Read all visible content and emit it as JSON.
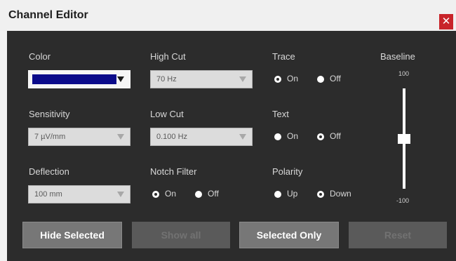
{
  "window": {
    "title": "Channel Editor",
    "close_glyph": "✕"
  },
  "color": {
    "label": "Color",
    "swatch": "#0a0a8a"
  },
  "high_cut": {
    "label": "High Cut",
    "value": "70 Hz"
  },
  "trace": {
    "label": "Trace",
    "on": "On",
    "off": "Off",
    "selected": "On"
  },
  "baseline": {
    "label": "Baseline",
    "max": "100",
    "min": "-100"
  },
  "sensitivity": {
    "label": "Sensitivity",
    "value": "7 µV/mm"
  },
  "low_cut": {
    "label": "Low Cut",
    "value": "0.100 Hz"
  },
  "text": {
    "label": "Text",
    "on": "On",
    "off": "Off",
    "selected": "Off"
  },
  "deflection": {
    "label": "Deflection",
    "value": "100 mm"
  },
  "notch_filter": {
    "label": "Notch Filter",
    "on": "On",
    "off": "Off",
    "selected": "On"
  },
  "polarity": {
    "label": "Polarity",
    "up": "Up",
    "down": "Down",
    "selected": "Down"
  },
  "buttons": {
    "hide_selected": "Hide Selected",
    "show_all": "Show all",
    "selected_only": "Selected Only",
    "reset": "Reset"
  }
}
